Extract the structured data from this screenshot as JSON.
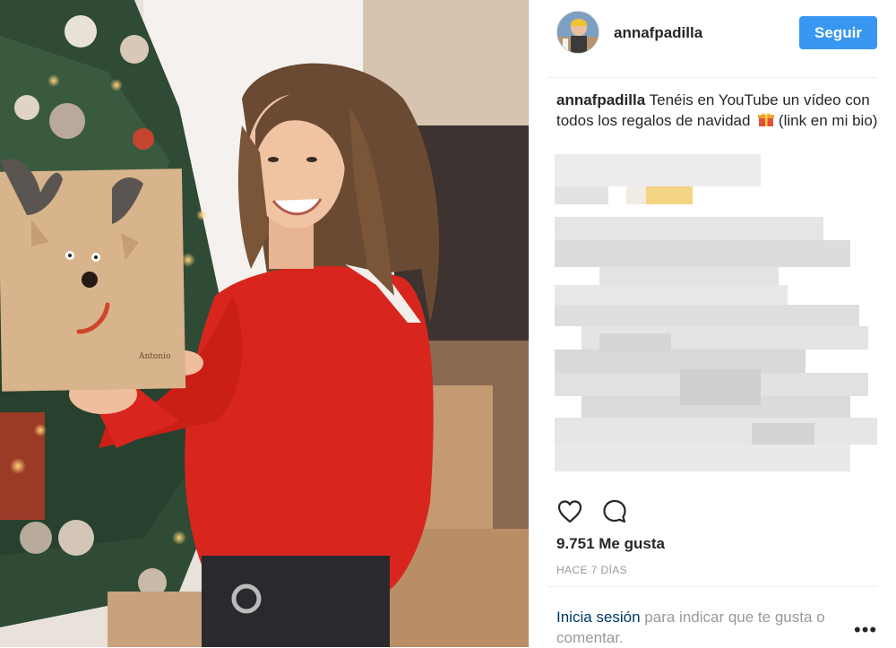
{
  "post": {
    "username": "annafpadilla",
    "follow_label": "Seguir",
    "caption_author": "annafpadilla",
    "caption_text": "Tenéis en YouTube un vídeo con todos los regalos de navidad",
    "caption_tail": "(link en mi bio)",
    "likes": "9.751 Me gusta",
    "timestamp": "HACE 7 DÍAS",
    "login_link": "Inicia sesión",
    "login_text": "para indicar que te gusta o comentar.",
    "more": "•••"
  },
  "gift_label": "Antonio",
  "icons": {
    "like": "heart-icon",
    "comment": "comment-bubble-icon",
    "gift": "gift-emoji-icon",
    "more": "more-options-icon"
  },
  "colors": {
    "follow_button": "#3897f0",
    "link": "#003569",
    "muted_text": "#999999",
    "sweater": "#d8261e"
  }
}
